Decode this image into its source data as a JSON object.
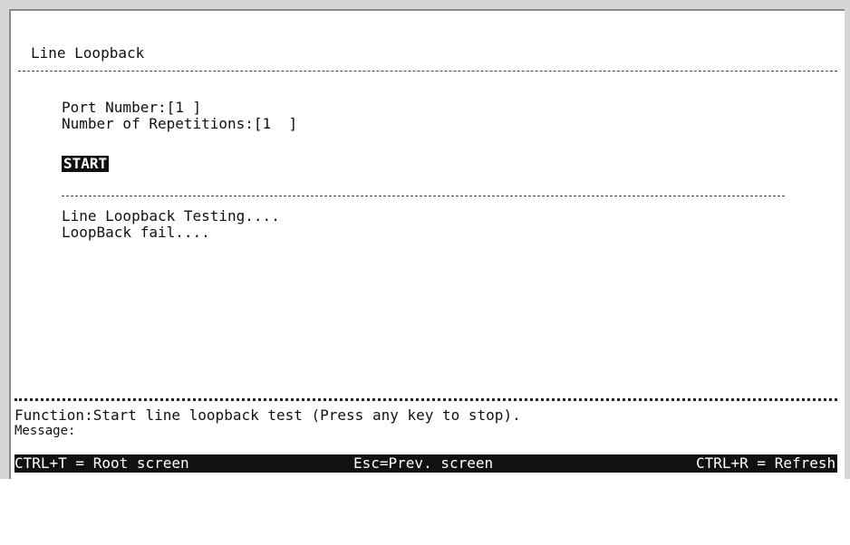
{
  "screen": {
    "title": "Line Loopback"
  },
  "fields": {
    "port_number_label": "Port Number:",
    "port_number_value": "[1 ]",
    "repetitions_label": "Number of Repetitions:",
    "repetitions_value": "[1  ]"
  },
  "actions": {
    "start_label": "START"
  },
  "output": {
    "lines": [
      "Line Loopback Testing....",
      "LoopBack fail...."
    ]
  },
  "status": {
    "function_text": "Function:Start line loopback test (Press any key to stop).",
    "message_text": "Message:"
  },
  "shortcuts": {
    "root": "CTRL+T = Root screen",
    "prev": "Esc=Prev. screen",
    "refresh": "CTRL+R = Refresh"
  },
  "colors": {
    "background": "#ffffff",
    "text": "#111111",
    "bar": "#111111",
    "bar_text": "#ffffff"
  }
}
